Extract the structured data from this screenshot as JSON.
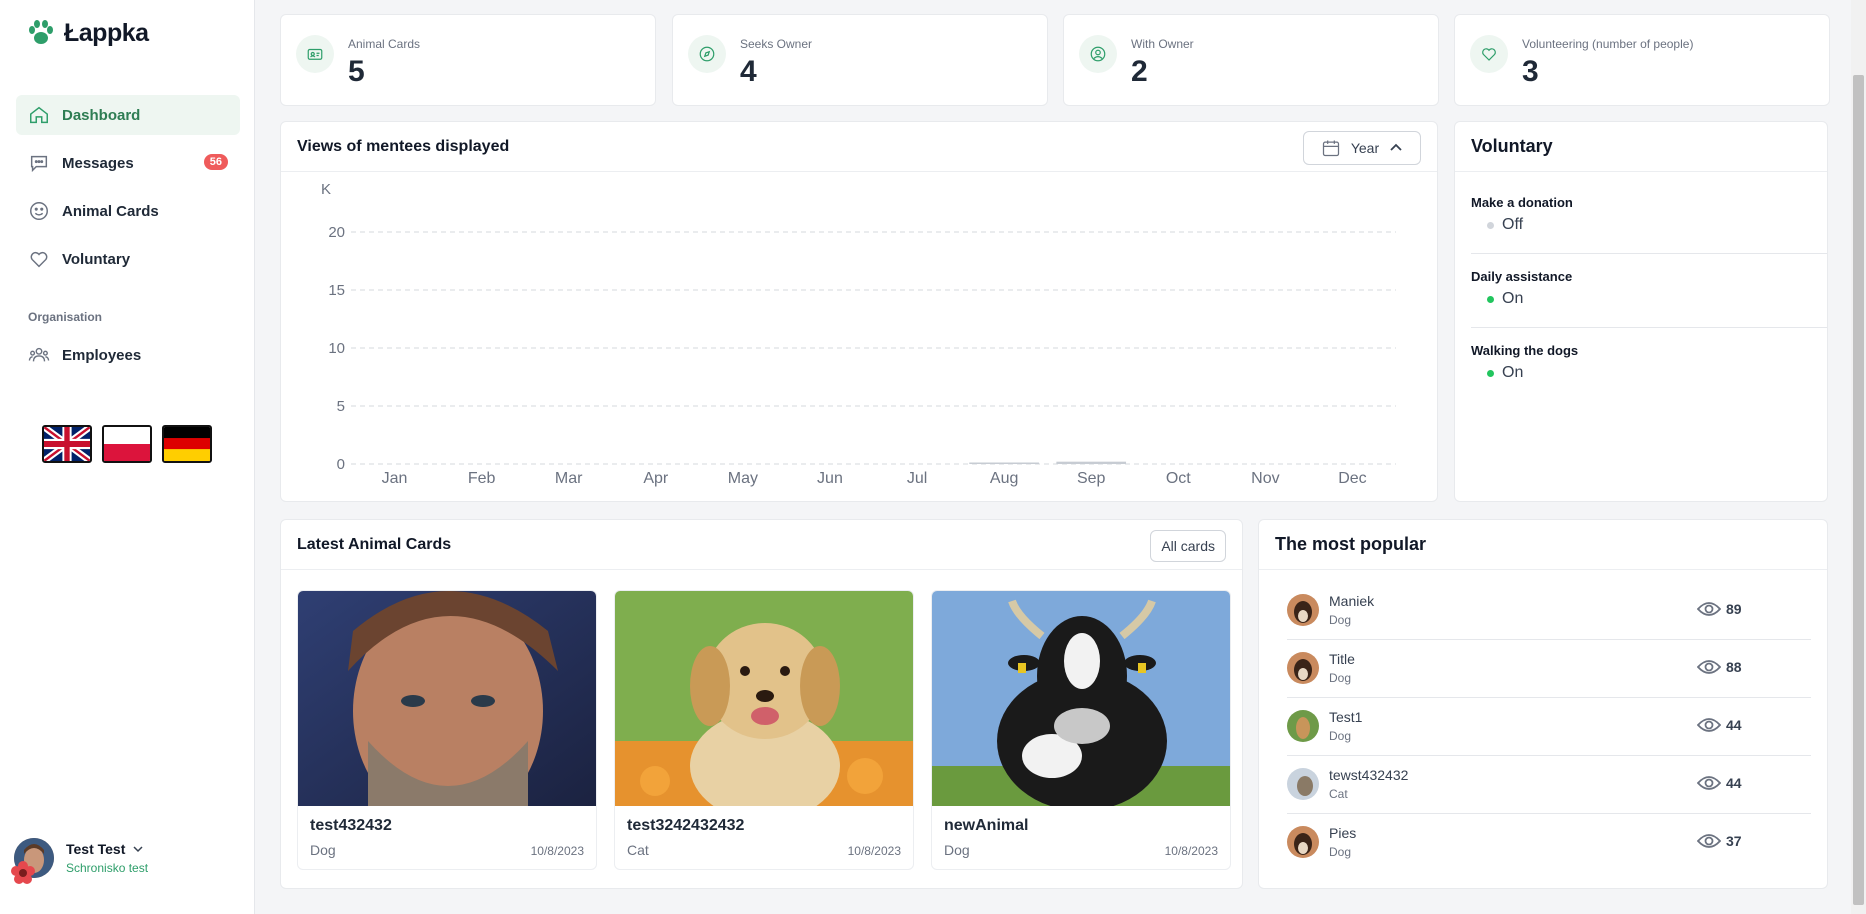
{
  "brand": {
    "name": "Łappka",
    "accent": "#2e9e6a"
  },
  "sidebar": {
    "items": [
      {
        "label": "Dashboard",
        "icon": "home-icon",
        "active": true
      },
      {
        "label": "Messages",
        "icon": "chat-icon",
        "badge": "56"
      },
      {
        "label": "Animal Cards",
        "icon": "smile-icon"
      },
      {
        "label": "Voluntary",
        "icon": "heart-icon"
      }
    ],
    "section_label": "Organisation",
    "org_items": [
      {
        "label": "Employees",
        "icon": "users-icon"
      }
    ],
    "languages": [
      "uk-flag",
      "pl-flag",
      "de-flag"
    ]
  },
  "user": {
    "name": "Test Test",
    "org": "Schronisko test"
  },
  "stats": [
    {
      "label": "Animal Cards",
      "value": "5",
      "icon": "id-card-icon"
    },
    {
      "label": "Seeks Owner",
      "value": "4",
      "icon": "compass-icon"
    },
    {
      "label": "With Owner",
      "value": "2",
      "icon": "user-circle-icon"
    },
    {
      "label": "Volunteering (number of people)",
      "value": "3",
      "icon": "heart-icon"
    }
  ],
  "views_chart": {
    "title": "Views of mentees displayed",
    "period": "Year",
    "unit": "K"
  },
  "chart_data": {
    "type": "bar",
    "categories": [
      "Jan",
      "Feb",
      "Mar",
      "Apr",
      "May",
      "Jun",
      "Jul",
      "Aug",
      "Sep",
      "Oct",
      "Nov",
      "Dec"
    ],
    "values": [
      0,
      0,
      0,
      0,
      0,
      0,
      0,
      0.05,
      0.2,
      0,
      0,
      0
    ],
    "ylabel": "K",
    "yticks": [
      0,
      5,
      10,
      15,
      20
    ],
    "ylim": [
      0,
      20
    ],
    "grid": true
  },
  "voluntary": {
    "title": "Voluntary",
    "items": [
      {
        "title": "Make a donation",
        "status": "Off",
        "color": "#d1d5db"
      },
      {
        "title": "Daily assistance",
        "status": "On",
        "color": "#22c55e"
      },
      {
        "title": "Walking the dogs",
        "status": "On",
        "color": "#22c55e"
      }
    ]
  },
  "latest": {
    "title": "Latest Animal Cards",
    "all_button": "All cards",
    "cards": [
      {
        "name": "test432432",
        "type": "Dog",
        "date": "10/8/2023"
      },
      {
        "name": "test3242432432",
        "type": "Cat",
        "date": "10/8/2023"
      },
      {
        "name": "newAnimal",
        "type": "Dog",
        "date": "10/8/2023"
      }
    ]
  },
  "popular": {
    "title": "The most popular",
    "items": [
      {
        "name": "Maniek",
        "type": "Dog",
        "views": "89"
      },
      {
        "name": "Title",
        "type": "Dog",
        "views": "88"
      },
      {
        "name": "Test1",
        "type": "Dog",
        "views": "44"
      },
      {
        "name": "tewst432432",
        "type": "Cat",
        "views": "44"
      },
      {
        "name": "Pies",
        "type": "Dog",
        "views": "37"
      }
    ]
  }
}
